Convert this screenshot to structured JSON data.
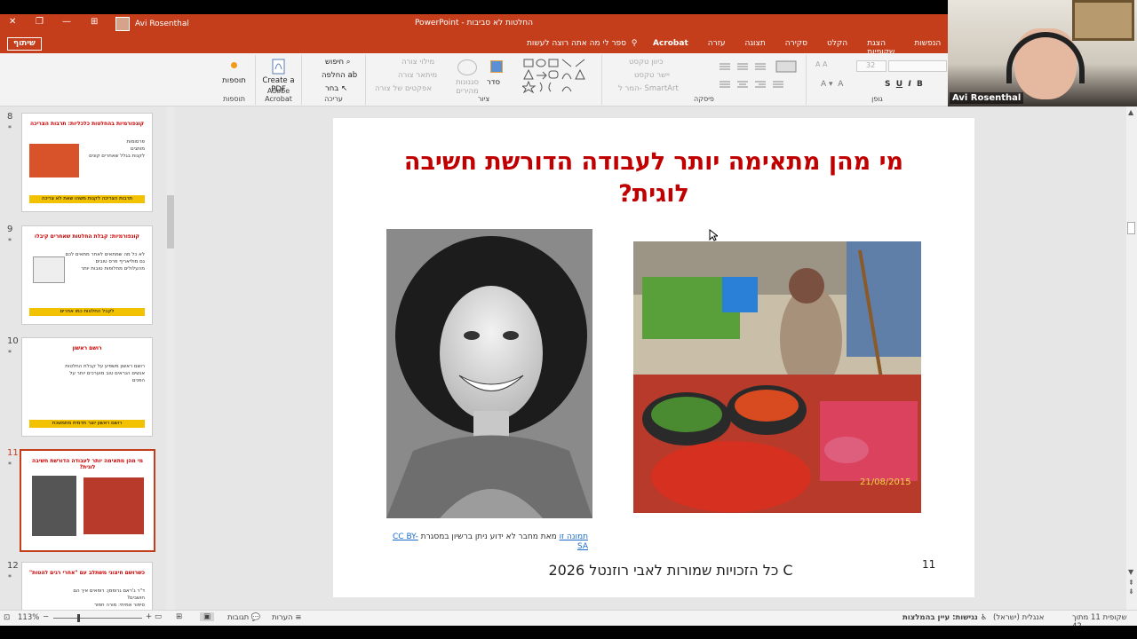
{
  "window": {
    "app_title": "PowerPoint - החלטות לא סביבות",
    "user_name": "Avi Rosenthal",
    "close_glyph": "✕",
    "restore_glyph": "❐",
    "minimize_glyph": "—",
    "layout_glyph": "⊞"
  },
  "ribbon_tabs": {
    "share_label": "שיתוף",
    "tell_me": "ספר לי מה אתה רוצה לעשות",
    "tabs": [
      "Acrobat",
      "עזרה",
      "תצוגה",
      "סקירה",
      "הקלט",
      "הצגת שקופיות",
      "הנפשות",
      "מ"
    ]
  },
  "ribbon": {
    "addins_label": "תוספות",
    "addins_group": "תוספות",
    "create_pdf_label": "Create a PDF",
    "adobe_group": "Adobe Acrobat",
    "find_label": "חיפוש",
    "replace_label": "החלפה",
    "select_label": "בחר",
    "editing_group": "עריכה",
    "arrange_label": "סדר",
    "quick_styles_label": "סגנונות מהירים",
    "shape_fill_label": "מילוי צורה",
    "shape_outline_label": "מיתאר צורה",
    "shape_effects_label": "אפקטים של צורה",
    "drawing_group": "ציור",
    "text_direction_label": "כיוון טקסט",
    "align_text_label": "יישר טקסט",
    "smartart_label": "המר ל- SmartArt",
    "paragraph_group": "פיסקה",
    "font_size": "32",
    "font_group": "גופן",
    "bold": "B",
    "italic": "I",
    "underline": "U",
    "shadow": "S"
  },
  "video": {
    "participant_name": "Avi Rosenthal"
  },
  "thumbnails": [
    {
      "number": "8",
      "star": "*",
      "title": "קונפורמיות בהחלטות כלכליות: תרבות הצריכה",
      "lines": [
        "פרסומות",
        "מותגים",
        "לקנות בגלל שאחרים קונים"
      ],
      "bar": "תרבות הצריכה לקנות משהו שאת לא צריכה"
    },
    {
      "number": "9",
      "star": "*",
      "title": "קונפורמיות: קבלת החלטות שאחרים קיבלו",
      "lines": [
        "לא כל מה שמתאים לאחר מתאים לכם",
        "גם מוליאריף פרס טובים",
        "מהעלולים מחלופות טובות יותר"
      ],
      "bar": "לקבל החלטות כמו אחרים"
    },
    {
      "number": "10",
      "star": "*",
      "title": "רושם ראשון",
      "lines": [
        "רושם ראשון משפיע על קבלת החלטות",
        "אנשים הנראים טוב מוערכים יותר על הפנים"
      ],
      "bar": "רושם ראשון יוצר תדמית מתמשכת"
    },
    {
      "number": "11",
      "star": "*",
      "title": "מי מהן מתאימה יותר לעבודה הדורשת חשיבה לוגית?",
      "lines": [],
      "bar": ""
    },
    {
      "number": "12",
      "star": "*",
      "title": "כשרושם חיצוני משתלב עם \"אחרי רגים להטות\"",
      "lines": [
        "ד\"ר ג'ראם גרופמן: רופאים איך הם חושבים?",
        "סיפור אמיתי: מורה חפוּר",
        "על אבחנות שלא נראית טוב ורופאים לא"
      ],
      "bar": ""
    }
  ],
  "slide": {
    "title": "מי מהן מתאימה יותר לעבודה הדורשת חשיבה לוגית?",
    "credit_link": "תמונה זו",
    "credit_middle": " מאת מחבר לא ידוע ניתן ברשיון במסגרת ",
    "credit_license": "CC BY-SA",
    "copyright": "C כל הזכויות שמורות לאבי רוזנטל 2026",
    "number": "11",
    "image_date": "21/08/2015"
  },
  "status": {
    "slide_counter": "שקופית 11 מתוך 42",
    "language": "אנגלית (ישראל)",
    "accessibility": "נגישות: עיין בהמלצות",
    "notes_label": "הערות",
    "comments_label": "תגובות",
    "zoom": "113%"
  }
}
